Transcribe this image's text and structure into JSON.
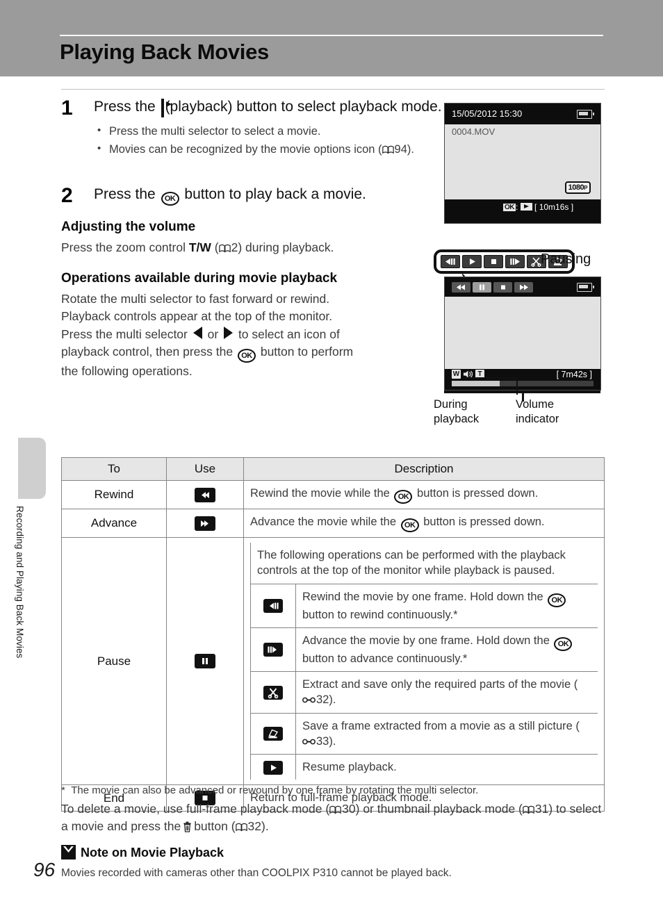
{
  "header": {
    "title": "Playing Back Movies"
  },
  "side_tab": {
    "label": "Recording and Playing Back Movies"
  },
  "page": {
    "number": "96"
  },
  "steps": [
    {
      "number": "1",
      "heading_before": "Press the",
      "heading_after": "(playback) button to select playback mode.",
      "bullets": [
        {
          "text": "Press the multi selector to select a movie."
        },
        {
          "pre": "Movies can be recognized by the movie options icon (",
          "ref": "94",
          "post": ")."
        }
      ]
    },
    {
      "number": "2",
      "heading_before": "Press the",
      "heading_after": "button to play back a movie."
    }
  ],
  "volume_section": {
    "heading": "Adjusting the volume",
    "text_before": "Press the zoom control",
    "control": "T/W",
    "ref": "2",
    "text_after": ") during playback."
  },
  "operations_section": {
    "heading": "Operations available during movie playback",
    "line1": "Rotate the multi selector to fast forward or rewind.",
    "line2": "Playback controls appear at the top of the monitor.",
    "line3a": "Press the multi selector",
    "line3b": "or",
    "line3c": "to select an icon of",
    "line4a": "playback control, then press the",
    "line4b": "button to perform",
    "line5": "the following operations."
  },
  "screen1": {
    "datetime": "15/05/2012  15:30",
    "filename": "0004.MOV",
    "badge": "1080",
    "badge_sub": "P",
    "ok_label": "OK",
    "separator": ":",
    "duration": "[  10m16s ]"
  },
  "screen2": {
    "duration": "[    7m42s ]",
    "vol_left": "W",
    "vol_right": "T",
    "controls": [
      {
        "name": "rewind",
        "selected": false
      },
      {
        "name": "pause",
        "selected": true
      },
      {
        "name": "stop",
        "selected": false
      },
      {
        "name": "fast-forward",
        "selected": false
      }
    ],
    "progress_percent": 34
  },
  "callout": {
    "label": "Pausing",
    "icons": [
      "frame-rewind",
      "play",
      "stop",
      "frame-advance",
      "scissors",
      "save-frame"
    ]
  },
  "captions": {
    "during_playback": "During\nplayback",
    "during_playback_line1": "During",
    "during_playback_line2": "playback",
    "volume_indicator_line1": "Volume",
    "volume_indicator_line2": "indicator"
  },
  "table": {
    "headers": [
      "To",
      "Use",
      "Description"
    ],
    "rows": [
      {
        "to": "Rewind",
        "icon": "rewind",
        "desc_before": "Rewind the movie while the",
        "desc_after": "button is pressed down."
      },
      {
        "to": "Advance",
        "icon": "fast-forward",
        "desc_before": "Advance the movie while the",
        "desc_after": "button is pressed down."
      },
      {
        "to": "Pause",
        "icon": "pause",
        "intro": "The following operations can be performed with the playback controls at the top of the monitor while playback is paused.",
        "sub_rows": [
          {
            "icon": "frame-rewind",
            "text_before": "Rewind the movie by one frame. Hold down the",
            "text_after": "button to rewind continuously.*"
          },
          {
            "icon": "frame-advance",
            "text_before": "Advance the movie by one frame. Hold down the",
            "text_after": "button to advance continuously.*"
          },
          {
            "icon": "scissors",
            "text_before": "Extract and save only the required parts of the movie (",
            "ref": "32",
            "text_after": ")."
          },
          {
            "icon": "save-frame",
            "text_before": "Save a frame extracted from a movie as a still picture (",
            "ref": "33",
            "text_after": ")."
          },
          {
            "icon": "play",
            "text_plain": "Resume playback."
          }
        ]
      },
      {
        "to": "End",
        "icon": "stop",
        "desc_plain": "Return to full-frame playback mode."
      }
    ]
  },
  "footnote": {
    "marker": "*",
    "text": "The movie can also be advanced or rewound by one frame by rotating the multi selector."
  },
  "delete_para": {
    "part1": "To delete a movie, use full-frame playback mode (",
    "ref1": "30",
    "part2": ") or thumbnail playback mode (",
    "ref2": "31",
    "part3": ") to select a movie and press the",
    "part4": "button (",
    "ref3": "32",
    "part5": ")."
  },
  "note": {
    "title": "Note on Movie Playback",
    "body": "Movies recorded with cameras other than COOLPIX P310 cannot be played back."
  },
  "colors": {
    "header_band": "#9b9b9b",
    "side_tab": "#cfcfcf",
    "table_header": "#e6e6e6",
    "border": "#858585",
    "screen_bg": "#0d0d0d",
    "screen_image": "#e2e2e2"
  }
}
